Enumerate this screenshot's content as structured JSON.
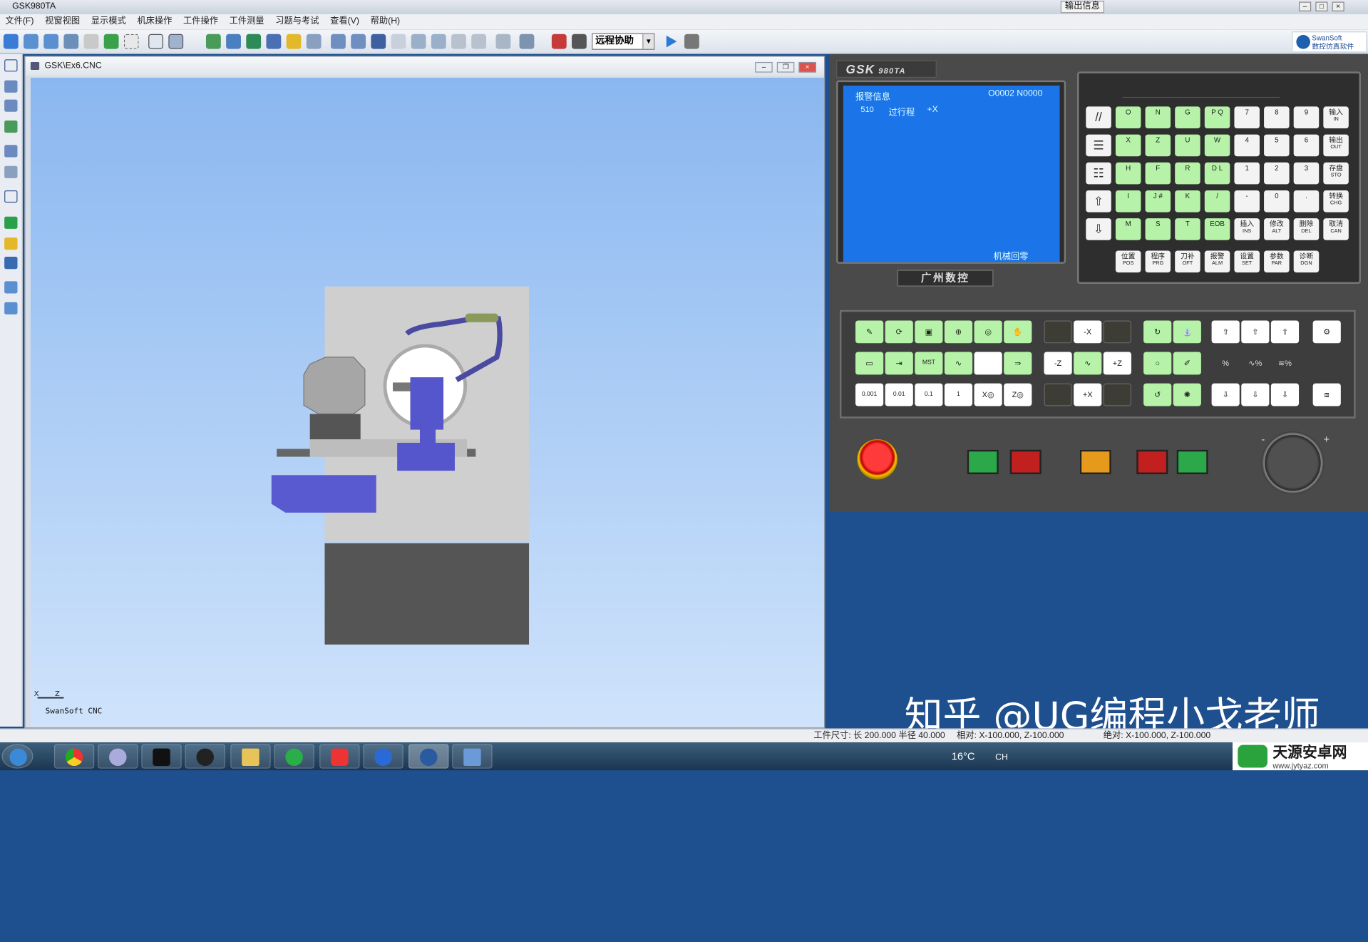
{
  "window": {
    "title": "GSK980TA",
    "output_tab": "输出信息"
  },
  "menu": [
    "文件(F)",
    "视窗视图",
    "显示模式",
    "机床操作",
    "工件操作",
    "工件测量",
    "习题与考试",
    "查看(V)",
    "帮助(H)"
  ],
  "toolbar": {
    "combo_value": "远程协助",
    "brand_line1": "SwanSoft",
    "brand_line2": "数控仿真软件"
  },
  "doc": {
    "title": "GSK\\Ex6.CNC",
    "footer": "SwanSoft CNC",
    "axis_x": "X",
    "axis_z": "Z"
  },
  "controller": {
    "logo": "GSK",
    "model": "980TA",
    "screen": {
      "heading": "报警信息",
      "program": "O0002  N0000",
      "alarm_code": "510",
      "alarm_text": "过行程",
      "alarm_axis": "+X",
      "mode": "机械回零"
    },
    "maker": "广州数控",
    "keys_row1": [
      "O",
      "N",
      "G",
      "P Q",
      "7",
      "8",
      "9"
    ],
    "keys_row2": [
      "X",
      "Z",
      "U",
      "W",
      "4",
      "5",
      "6"
    ],
    "keys_row3": [
      "H",
      "F",
      "R",
      "D L",
      "1",
      "2",
      "3"
    ],
    "keys_row4": [
      "I",
      "J #",
      "K",
      "/",
      "-",
      "0",
      "."
    ],
    "keys_row5": [
      "M",
      "S",
      "T",
      "EOB"
    ],
    "side_keys": [
      {
        "cn": "输入",
        "en": "IN"
      },
      {
        "cn": "输出",
        "en": "OUT"
      },
      {
        "cn": "存盘",
        "en": "STO"
      },
      {
        "cn": "转换",
        "en": "CHG"
      }
    ],
    "edit_keys": [
      {
        "cn": "插入",
        "en": "INS"
      },
      {
        "cn": "修改",
        "en": "ALT"
      },
      {
        "cn": "删除",
        "en": "DEL"
      },
      {
        "cn": "取消",
        "en": "CAN"
      }
    ],
    "func_keys": [
      {
        "cn": "位置",
        "en": "POS"
      },
      {
        "cn": "程序",
        "en": "PRG"
      },
      {
        "cn": "刀补",
        "en": "OFT"
      },
      {
        "cn": "报警",
        "en": "ALM"
      },
      {
        "cn": "设置",
        "en": "SET"
      },
      {
        "cn": "参数",
        "en": "PAR"
      },
      {
        "cn": "诊断",
        "en": "DGN"
      }
    ],
    "jog": {
      "minus_x": "-X",
      "plus_x": "+X",
      "minus_z": "-Z",
      "plus_z": "+Z"
    },
    "step": [
      "0.001",
      "0.01",
      "0.1",
      "1",
      "X◎",
      "Z◎"
    ],
    "hand_minus": "-",
    "hand_plus": "+"
  },
  "watermark": "知乎 @UG编程小戈老师",
  "status": {
    "size": "工件尺寸: 长 200.000 半径  40.000",
    "rel": "相对: X-100.000, Z-100.000",
    "abs": "绝对: X-100.000, Z-100.000"
  },
  "taskbar": {
    "weather": "16°C",
    "ime": "CH",
    "brand": "天源安卓网",
    "brand_url": "www.jytyaz.com"
  },
  "colors": {
    "screen_bg": "#1b74e8",
    "key_green": "#b6f2a8",
    "panel_bg": "#4a4a4a",
    "viewport_top": "#8ab7f0"
  }
}
